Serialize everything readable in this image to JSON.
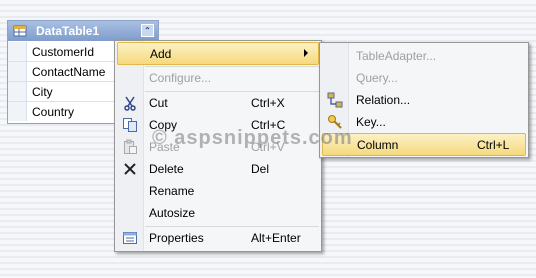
{
  "datatable": {
    "title": "DataTable1",
    "collapse_glyph": "⌃",
    "columns": [
      "CustomerId",
      "ContactName",
      "City",
      "Country"
    ]
  },
  "context_menu": {
    "add": "Add",
    "configure": "Configure...",
    "cut": "Cut",
    "cut_shortcut": "Ctrl+X",
    "copy": "Copy",
    "copy_shortcut": "Ctrl+C",
    "paste": "Paste",
    "paste_shortcut": "Ctrl+V",
    "delete": "Delete",
    "delete_shortcut": "Del",
    "rename": "Rename",
    "autosize": "Autosize",
    "properties": "Properties",
    "properties_shortcut": "Alt+Enter"
  },
  "add_submenu": {
    "table_adapter": "TableAdapter...",
    "query": "Query...",
    "relation": "Relation...",
    "key": "Key...",
    "column": "Column",
    "column_shortcut": "Ctrl+L"
  },
  "watermark": "© aspsnippets.com",
  "colors": {
    "header": "#8aa3c6",
    "highlight": "#f6d97d"
  }
}
